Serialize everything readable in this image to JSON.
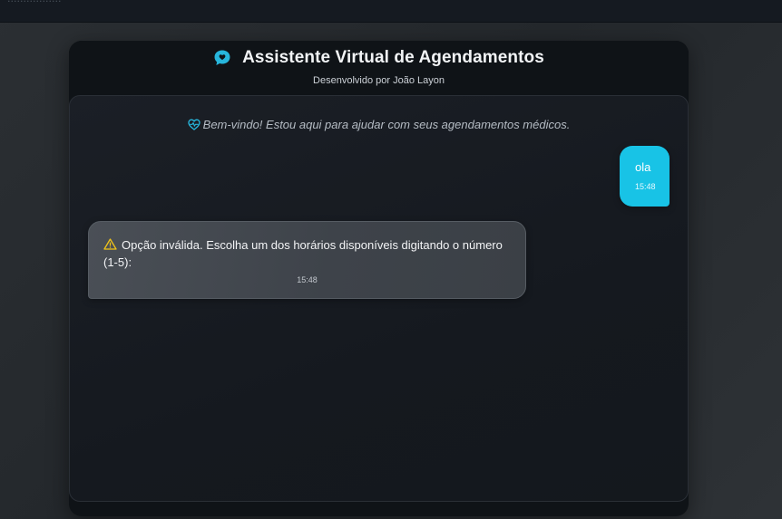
{
  "topbar": {
    "faded_text": "................."
  },
  "header": {
    "icon": "chat-bubble-heart-icon",
    "title": "Assistente Virtual de Agendamentos",
    "subtitle": "Desenvolvido por João Layon"
  },
  "chat": {
    "welcome_icon": "heart-pulse-icon",
    "welcome": "Bem-vindo! Estou aqui para ajudar com seus agendamentos médicos.",
    "messages": [
      {
        "sender": "user",
        "text": "ola",
        "time": "15:48"
      },
      {
        "sender": "bot",
        "icon": "warning-icon",
        "text": "Opção inválida. Escolha um dos horários disponíveis digitando o número (1-5):",
        "time": "15:48"
      }
    ]
  },
  "colors": {
    "accent": "#18c3e6",
    "background": "#2b2f33",
    "card": "#0f1317",
    "bot_bubble": "#43484f",
    "warning": "#f0c419"
  }
}
